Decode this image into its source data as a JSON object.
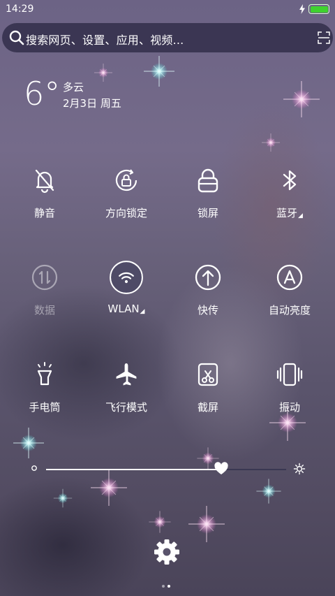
{
  "status": {
    "time": "14:29",
    "battery_color": "#3fd22f",
    "battery_level": 1.0
  },
  "search": {
    "placeholder": "搜索网页、设置、应用、视频..."
  },
  "weather": {
    "temp": "6°",
    "condition": "多云",
    "date": "2月3日 周五"
  },
  "toggles": [
    {
      "label": "静音",
      "icon": "bell-off-icon"
    },
    {
      "label": "方向锁定",
      "icon": "rotation-lock-icon"
    },
    {
      "label": "锁屏",
      "icon": "lock-icon"
    },
    {
      "label": "蓝牙",
      "icon": "bluetooth-icon",
      "has_submenu": true
    },
    {
      "label": "数据",
      "icon": "mobile-data-icon",
      "disabled": true
    },
    {
      "label": "WLAN",
      "icon": "wifi-icon",
      "active": true,
      "has_submenu": true
    },
    {
      "label": "快传",
      "icon": "quick-transfer-icon"
    },
    {
      "label": "自动亮度",
      "icon": "auto-brightness-icon"
    },
    {
      "label": "手电筒",
      "icon": "flashlight-icon"
    },
    {
      "label": "飞行模式",
      "icon": "airplane-icon"
    },
    {
      "label": "截屏",
      "icon": "screenshot-icon"
    },
    {
      "label": "振动",
      "icon": "vibrate-icon"
    }
  ],
  "brightness": {
    "level": 0.73,
    "thumb_icon": "heart-icon"
  },
  "pager": {
    "pages": 2,
    "current": 2
  },
  "colors": {
    "accent": "#ffffff",
    "dim_text": "rgba(255,255,255,0.45)"
  }
}
